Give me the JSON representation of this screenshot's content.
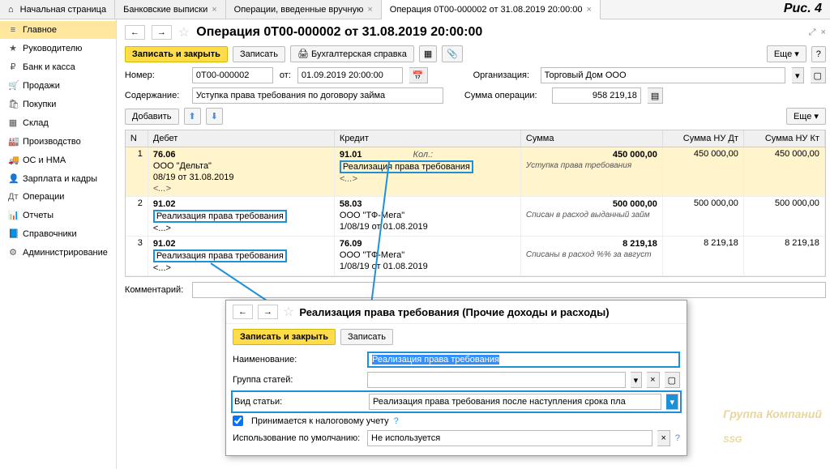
{
  "fig": "Рис. 4",
  "tabs": {
    "home": "Начальная страница",
    "t1": "Банковские выписки",
    "t2": "Операции, введенные вручную",
    "t3": "Операция 0Т00-000002 от 31.08.2019 20:00:00"
  },
  "sidebar": [
    {
      "icon": "≡",
      "label": "Главное"
    },
    {
      "icon": "★",
      "label": "Руководителю"
    },
    {
      "icon": "₽",
      "label": "Банк и касса"
    },
    {
      "icon": "🛒",
      "label": "Продажи"
    },
    {
      "icon": "🛍",
      "label": "Покупки"
    },
    {
      "icon": "▦",
      "label": "Склад"
    },
    {
      "icon": "🏭",
      "label": "Производство"
    },
    {
      "icon": "🚚",
      "label": "ОС и НМА"
    },
    {
      "icon": "👤",
      "label": "Зарплата и кадры"
    },
    {
      "icon": "Дт",
      "label": "Операции"
    },
    {
      "icon": "📊",
      "label": "Отчеты"
    },
    {
      "icon": "📘",
      "label": "Справочники"
    },
    {
      "icon": "⚙",
      "label": "Администрирование"
    }
  ],
  "title": "Операция 0Т00-000002 от 31.08.2019 20:00:00",
  "toolbar": {
    "save_close": "Записать и закрыть",
    "save": "Записать",
    "print": "Бухгалтерская справка",
    "more": "Еще"
  },
  "form": {
    "num_label": "Номер:",
    "num": "0Т00-000002",
    "from": "от:",
    "date": "01.09.2019 20:00:00",
    "org_label": "Организация:",
    "org": "Торговый Дом ООО",
    "content_label": "Содержание:",
    "content": "Уступка права требования по договору займа",
    "sum_label": "Сумма операции:",
    "sum": "958 219,18",
    "add": "Добавить",
    "comment_label": "Комментарий:"
  },
  "thead": {
    "n": "N",
    "d": "Дебет",
    "k": "Кредит",
    "s": "Сумма",
    "nud": "Сумма НУ Дт",
    "nuk": "Сумма НУ Кт"
  },
  "rows": [
    {
      "n": "1",
      "d1": "76.06",
      "d2": "ООО \"Дельта\"",
      "d3": "08/19 от 31.08.2019",
      "d4": "<...>",
      "k1": "91.01",
      "kcol": "Кол.:",
      "k2": "Реализация права требования",
      "k3": "<...>",
      "s": "450 000,00",
      "desc": "Уступка права требования",
      "nud": "450 000,00",
      "nuk": "450 000,00"
    },
    {
      "n": "2",
      "d1": "91.02",
      "d2": "Реализация права требования",
      "d3": "<...>",
      "k1": "58.03",
      "k2": "ООО \"ТФ-Мега\"",
      "k3": "1/08/19 от 01.08.2019",
      "s": "500 000,00",
      "desc": "Списан в расход выданный займ",
      "nud": "500 000,00",
      "nuk": "500 000,00"
    },
    {
      "n": "3",
      "d1": "91.02",
      "d2": "Реализация права требования",
      "d3": "<...>",
      "k1": "76.09",
      "k2": "ООО \"ТФ-Мега\"",
      "k3": "1/08/19 от 01.08.2019",
      "s": "8 219,18",
      "desc": "Списаны в расход %% за август",
      "nud": "8 219,18",
      "nuk": "8 219,18"
    }
  ],
  "popup": {
    "title": "Реализация права требования (Прочие доходы и расходы)",
    "save_close": "Записать и закрыть",
    "save": "Записать",
    "name_label": "Наименование:",
    "name": "Реализация права требования",
    "group_label": "Группа статей:",
    "type_label": "Вид статьи:",
    "type": "Реализация права требования после наступления срока пла",
    "tax": "Принимается к налоговому учету",
    "tax_checked": true,
    "default_label": "Использование по умолчанию:",
    "default": "Не используется"
  },
  "watermark": {
    "line1": "Группа Компаний",
    "line2": "SSG"
  }
}
